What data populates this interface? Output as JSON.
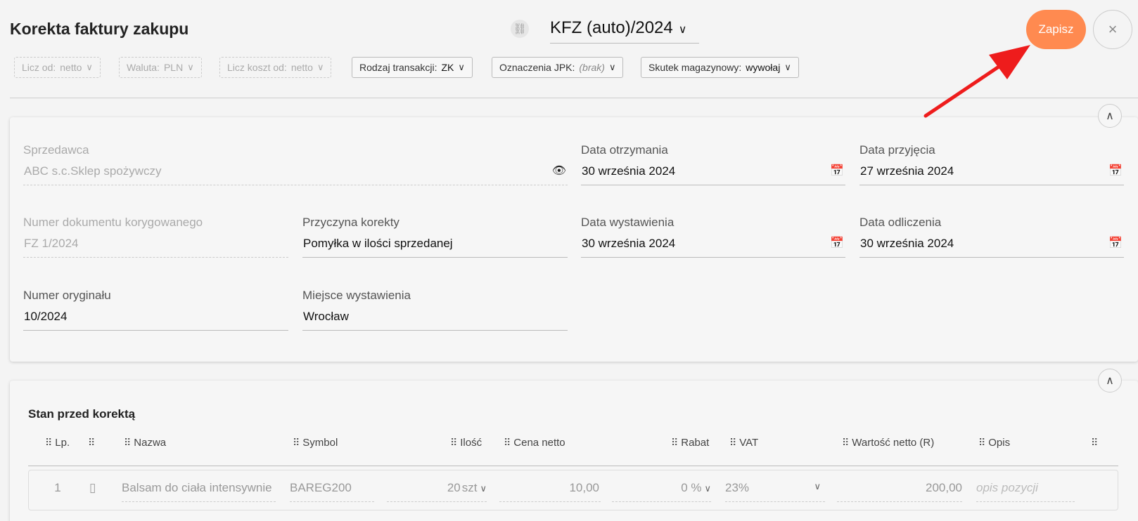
{
  "header": {
    "title": "Korekta faktury zakupu",
    "doc_number": "KFZ (auto)/2024",
    "save_label": "Zapisz",
    "close_label": "×"
  },
  "options": [
    {
      "label": "Licz od:",
      "value": "netto",
      "enabled": false
    },
    {
      "label": "Waluta:",
      "value": "PLN",
      "enabled": false
    },
    {
      "label": "Licz koszt od:",
      "value": "netto",
      "enabled": false
    },
    {
      "label": "Rodzaj transakcji:",
      "value": "ZK",
      "enabled": true
    },
    {
      "label": "Oznaczenia JPK:",
      "value": "(brak)",
      "enabled": true
    },
    {
      "label": "Skutek magazynowy:",
      "value": "wywołaj",
      "enabled": true
    }
  ],
  "form": {
    "seller": {
      "label": "Sprzedawca",
      "value": "ABC s.c.Sklep spożywczy"
    },
    "received_date": {
      "label": "Data otrzymania",
      "value": "30 września 2024"
    },
    "accepted_date": {
      "label": "Data przyjęcia",
      "value": "27 września 2024"
    },
    "corrected_doc": {
      "label": "Numer dokumentu korygowanego",
      "value": "FZ 1/2024"
    },
    "reason": {
      "label": "Przyczyna korekty",
      "value": "Pomyłka w ilości sprzedanej"
    },
    "issue_date": {
      "label": "Data wystawienia",
      "value": "30 września 2024"
    },
    "deduction_date": {
      "label": "Data odliczenia",
      "value": "30 września 2024"
    },
    "original_number": {
      "label": "Numer oryginału",
      "value": "10/2024"
    },
    "issue_place": {
      "label": "Miejsce wystawienia",
      "value": "Wrocław"
    }
  },
  "items_section": {
    "title": "Stan przed korektą",
    "columns": [
      "Lp.",
      "",
      "Nazwa",
      "Symbol",
      "Ilość",
      "Cena netto",
      "Rabat",
      "VAT",
      "Wartość netto (R)",
      "Opis"
    ],
    "rows": [
      {
        "lp": "1",
        "name": "Balsam do ciała intensywnie",
        "symbol": "BAREG200",
        "qty": "20",
        "unit": "szt",
        "price": "10,00",
        "discount": "0 %",
        "vat": "23%",
        "net_value": "200,00",
        "description_placeholder": "opis pozycji"
      }
    ]
  },
  "colors": {
    "accent": "#ff8a50",
    "annotation_arrow": "#ee1c1c"
  }
}
